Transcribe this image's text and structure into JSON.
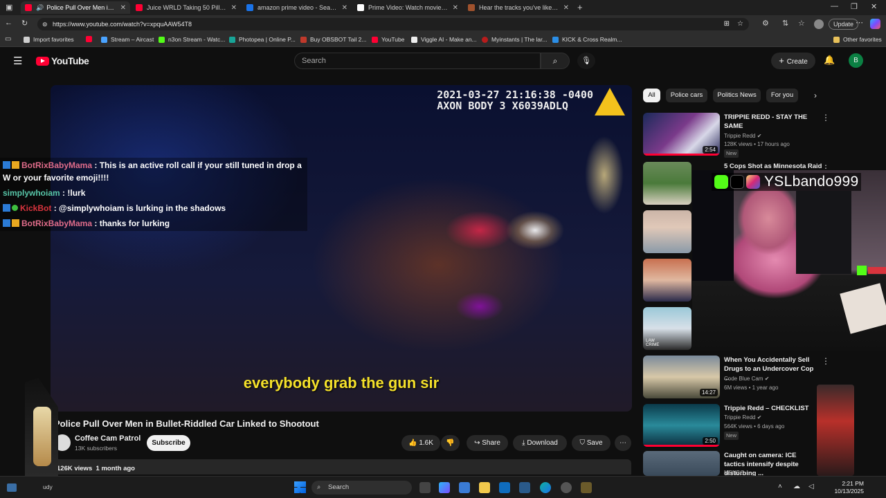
{
  "browser": {
    "tabs": [
      {
        "title": "Police Pull Over Men in Bulle",
        "active": true
      },
      {
        "title": "Juice WRLD Taking 50 Pills Becau"
      },
      {
        "title": "amazon prime video - Search"
      },
      {
        "title": "Prime Video: Watch movies, TV sh"
      },
      {
        "title": "Hear the tracks you've liked: on S"
      }
    ],
    "url": "https://www.youtube.com/watch?v=xpquAAW54T8",
    "update_label": "Update",
    "profile_initial": "B",
    "bookmarks": [
      "Import favorites",
      "Stream – Aircast",
      "n3on Stream - Watc...",
      "Photopea | Online P...",
      "Buy OBSBOT Tail 2...",
      "YouTube",
      "Viggle AI - Make an...",
      "Myinstants | The lar...",
      "KICK & Cross Realm..."
    ],
    "other_favorites": "Other favorites"
  },
  "youtube": {
    "logo": "YouTube",
    "search_placeholder": "Search",
    "create_label": "Create",
    "avatar_initial": "B"
  },
  "video": {
    "timestamp": "2021-03-27 21:16:38 -0400",
    "camera": "AXON BODY 3 X6039ADLQ",
    "subtitle": "everybody grab the gun sir",
    "title": "Police Pull Over Men in Bullet-Riddled Car Linked to Shootout",
    "channel": "Coffee Cam Patrol",
    "subscribers": "13K subscribers",
    "subscribe_label": "Subscribe",
    "likes": "1.6K",
    "share_label": "Share",
    "download_label": "Download",
    "save_label": "Save",
    "views": "126K views",
    "age": "1 month ago"
  },
  "chat": [
    {
      "user": "BotRixBabyMama",
      "user_color": "#e06c8a",
      "text": ": This is an active roll call if your still tuned in drop a W or your favorite emoji!!!!",
      "badges": 2
    },
    {
      "user": "simplywhoiam",
      "user_color": "#58c6a8",
      "text": ": !lurk",
      "badges": 0
    },
    {
      "user": "KickBot",
      "user_color": "#d9343d",
      "text": ": @simplywhoiam is lurking in the shadows",
      "badges": 3
    },
    {
      "user": "BotRixBabyMama",
      "user_color": "#e06c8a",
      "text": ": thanks for lurking",
      "badges": 2
    }
  ],
  "sidebar": {
    "chips": [
      "All",
      "Police cars",
      "Politics News",
      "For you"
    ],
    "videos": [
      {
        "title": "TRIPPIE REDD - STAY THE SAME",
        "channel": "Trippie Redd",
        "meta": "128K views • 17 hours ago",
        "badge": "New",
        "duration": "2:54"
      },
      {
        "title": "5 Cops Shot as Minnesota Raid"
      },
      {
        "title": "When You Accidentally Sell Drugs to an Undercover Cop ...",
        "channel": "Code Blue Cam",
        "meta": "6M views • 1 year ago",
        "duration": "14:27"
      },
      {
        "title": "Trippie Redd – CHECKLIST",
        "channel": "Trippie Redd",
        "meta": "564K views • 6 days ago",
        "badge": "New",
        "duration": "2:50"
      },
      {
        "title": "Caught on camera: ICE tactics intensify despite disturbing ...",
        "channel": "MSNBC"
      }
    ],
    "thumb_label": "LAW CRIME"
  },
  "stream_overlay": {
    "handle": "YSLbando999"
  },
  "taskbar": {
    "search_label": "Search",
    "time": "2:21 PM",
    "date": "10/13/2025",
    "weather": "udy"
  }
}
